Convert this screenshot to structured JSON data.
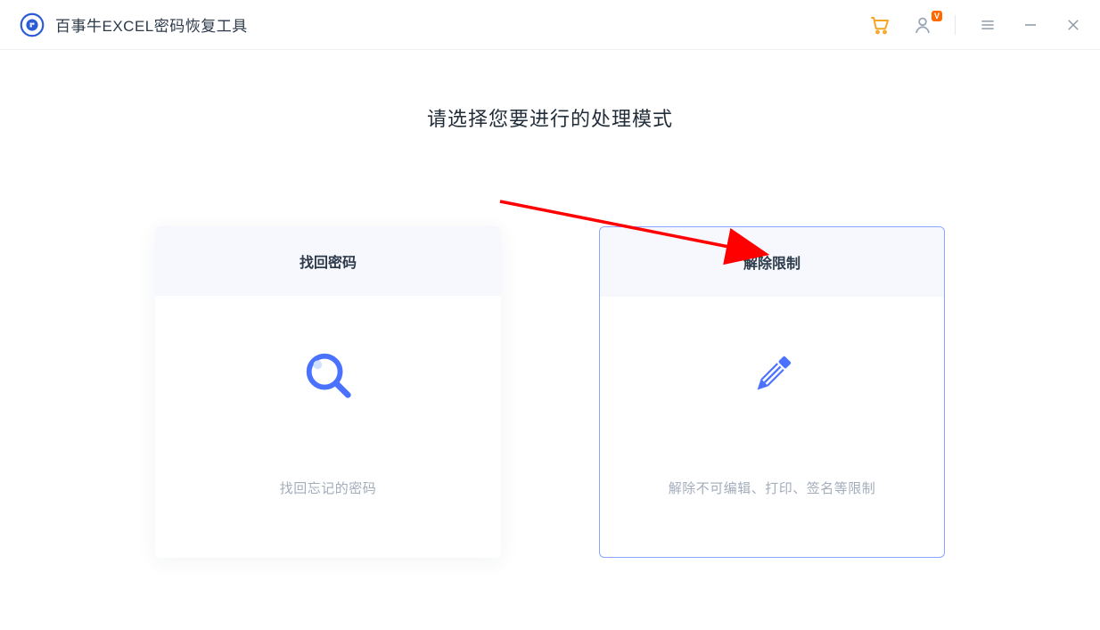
{
  "app": {
    "title": "百事牛EXCEL密码恢复工具",
    "vip_badge": "V"
  },
  "main": {
    "heading": "请选择您要进行的处理模式"
  },
  "cards": [
    {
      "title": "找回密码",
      "desc": "找回忘记的密码",
      "selected": false,
      "icon": "search"
    },
    {
      "title": "解除限制",
      "desc": "解除不可编辑、打印、签名等限制",
      "selected": true,
      "icon": "pencil"
    }
  ]
}
